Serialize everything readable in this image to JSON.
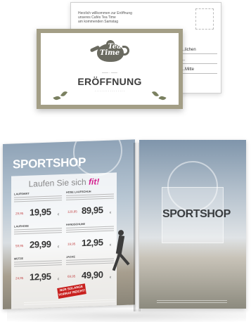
{
  "postcard": {
    "back_lines": [
      "Herzlich willkommen zur Eröffnung",
      "unseres Cafés Tea Time",
      "am kommenden Samstag"
    ],
    "front_address": [
      "...lichen",
      "...",
      "...Mitte"
    ],
    "brand_line1": "Tea",
    "brand_line2": "Time",
    "title": "ERÖFFNUNG"
  },
  "brochure": {
    "left_title": "SPORTSHOP",
    "headline": "Laufen Sie sich",
    "headline_highlight": "fit!",
    "right_title": "SPORTSHOP",
    "badge": "NUR SOLANGE VORRAT REICHT!",
    "products": [
      {
        "category": "LAUFSHIRT",
        "old": "29,95",
        "price": "19,95",
        "currency": "€"
      },
      {
        "category": "HOSE LAUFSCHUH",
        "old": "129,95",
        "price": "89,95",
        "currency": "€"
      },
      {
        "category": "LAUFHOSE",
        "old": "59,95",
        "price": "29,99",
        "currency": "€"
      },
      {
        "category": "HANDSCHUHE",
        "old": "19,95",
        "price": "12,95",
        "currency": "€"
      },
      {
        "category": "MÜTZE",
        "old": "24,95",
        "price": "12,95",
        "currency": "€"
      },
      {
        "category": "JACKE",
        "old": "69,95",
        "price": "49,90",
        "currency": "€"
      }
    ]
  },
  "colors": {
    "accent_magenta": "#d31c8c",
    "frame_olive": "#a39e86",
    "badge_red": "#c8201e"
  }
}
